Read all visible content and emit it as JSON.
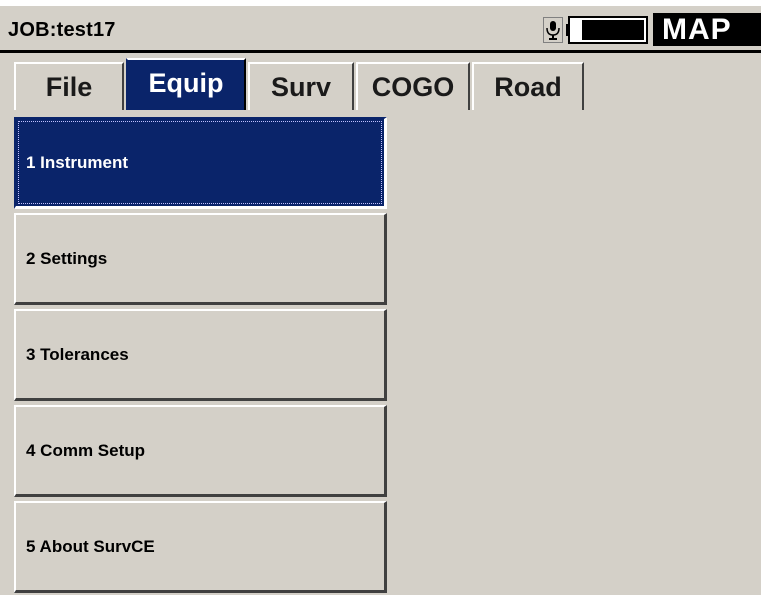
{
  "titlebar": {
    "job_title": "JOB:test17",
    "mode_label": "MAP",
    "icons": [
      "microphone-icon",
      "battery-icon"
    ]
  },
  "tabs": [
    {
      "label": "File",
      "active": false
    },
    {
      "label": "Equip",
      "active": true
    },
    {
      "label": "Surv",
      "active": false
    },
    {
      "label": "COGO",
      "active": false
    },
    {
      "label": "Road",
      "active": false
    }
  ],
  "menu": {
    "items": [
      {
        "label": "1 Instrument",
        "selected": true
      },
      {
        "label": "2 Settings",
        "selected": false
      },
      {
        "label": "3 Tolerances",
        "selected": false
      },
      {
        "label": "4 Comm Setup",
        "selected": false
      },
      {
        "label": "5 About SurvCE",
        "selected": false
      }
    ]
  },
  "colors": {
    "background": "#d4d0c8",
    "selection": "#0a246a",
    "mode_box": "#000000"
  }
}
